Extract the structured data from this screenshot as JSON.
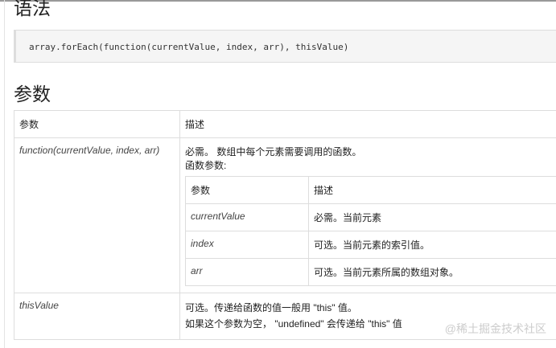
{
  "syntax_heading": "语法",
  "code": "array.forEach(function(currentValue, index, arr), thisValue)",
  "params_heading": "参数",
  "table": {
    "headers": [
      "参数",
      "描述"
    ],
    "row1": {
      "param": "function(currentValue, index, arr)",
      "desc": "必需。 数组中每个元素需要调用的函数。",
      "sub": "函数参数:",
      "inner_headers": [
        "参数",
        "描述"
      ],
      "inner_rows": [
        {
          "p": "currentValue",
          "d": "必需。当前元素"
        },
        {
          "p": "index",
          "d": "可选。当前元素的索引值。"
        },
        {
          "p": "arr",
          "d": "可选。当前元素所属的数组对象。"
        }
      ]
    },
    "row2": {
      "param": "thisValue",
      "desc1": "可选。传递给函数的值一般用 \"this\" 值。",
      "desc2": "如果这个参数为空， \"undefined\" 会传递给 \"this\" 值"
    }
  },
  "watermark": "@稀土掘金技术社区"
}
